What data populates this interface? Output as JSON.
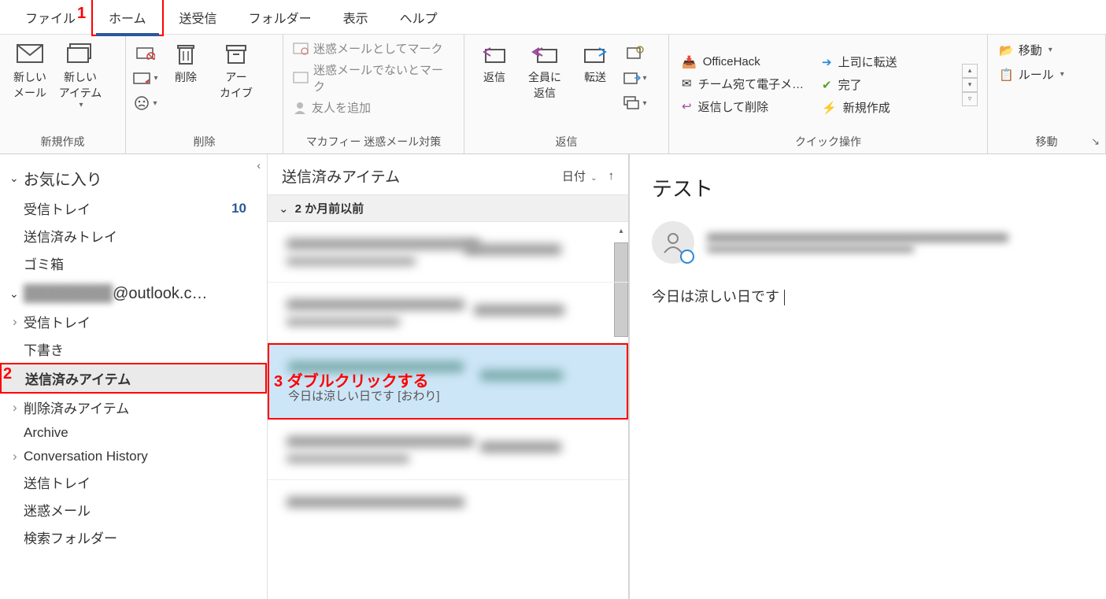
{
  "menubar": {
    "file": "ファイル",
    "home": "ホーム",
    "sendreceive": "送受信",
    "folder": "フォルダー",
    "view": "表示",
    "help": "ヘルプ"
  },
  "ribbon": {
    "new_group": "新規作成",
    "new_mail": "新しい\nメール",
    "new_item": "新しい\nアイテム",
    "delete_group": "削除",
    "delete_btn": "削除",
    "archive_btn": "アー\nカイブ",
    "mcafee_group": "マカフィー 迷惑メール対策",
    "mark_junk": "迷惑メールとしてマーク",
    "mark_notjunk": "迷惑メールでないとマーク",
    "add_friend": "友人を追加",
    "reply_group": "返信",
    "reply": "返信",
    "reply_all": "全員に\n返信",
    "forward": "転送",
    "quick_group": "クイック操作",
    "quick_officehack": "OfficeHack",
    "quick_team": "チーム宛て電子メ…",
    "quick_reply_delete": "返信して削除",
    "quick_fwd_boss": "上司に転送",
    "quick_done": "完了",
    "quick_create": "新規作成",
    "move_group": "移動",
    "move_btn": "移動",
    "rules_btn": "ルール"
  },
  "nav": {
    "favorites": "お気に入り",
    "inbox": "受信トレイ",
    "inbox_count": "10",
    "sent_tray": "送信済みトレイ",
    "trash": "ゴミ箱",
    "account_suffix": "@outlook.c…",
    "inbox2": "受信トレイ",
    "drafts": "下書き",
    "sent_items": "送信済みアイテム",
    "deleted_items": "削除済みアイテム",
    "archive": "Archive",
    "conv_history": "Conversation History",
    "outbox": "送信トレイ",
    "junk": "迷惑メール",
    "search_folders": "検索フォルダー"
  },
  "msglist": {
    "title": "送信済みアイテム",
    "sort_label": "日付",
    "group_header": "2 か月前以前",
    "selected_preview": "今日は涼しい日です  [おわり]"
  },
  "reading": {
    "subject": "テスト",
    "body": "今日は涼しい日です"
  },
  "annotations": {
    "a1": "1",
    "a2": "2",
    "a3": "3 ダブルクリックする"
  }
}
